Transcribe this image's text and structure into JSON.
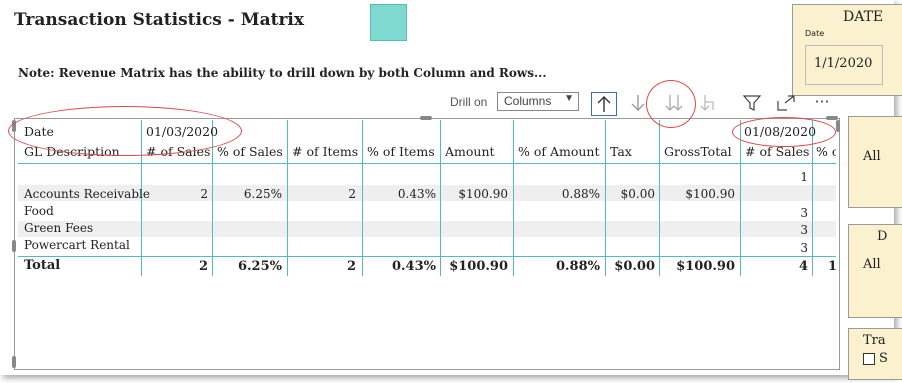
{
  "page": {
    "title": "Transaction Statistics - Matrix",
    "note": "Note: Revenue Matrix has the ability to drill down by both Column and Rows..."
  },
  "slicers": {
    "date_header": "DATE",
    "date_label": "Date",
    "date_value": "1/1/2020",
    "slicer2_value": "All",
    "slicer3_header": "D",
    "slicer3_value": "All",
    "slicer4_header": "Tra",
    "slicer4_option": "S"
  },
  "toolbar": {
    "drill_label": "Drill on",
    "drill_value": "Columns",
    "more_label": "···"
  },
  "matrix": {
    "date_row_label": "Date",
    "date1": "01/03/2020",
    "date2": "01/08/2020",
    "row_header": "GL Description",
    "col_headers": [
      "# of Sales",
      "% of Sales",
      "# of Items",
      "% of Items",
      "Amount",
      "% of Amount",
      "Tax",
      "GrossTotal",
      "# of Sales",
      "% c"
    ],
    "top_row_value": "1",
    "rows": [
      {
        "label": "Accounts Receivable",
        "sales": "2",
        "pct_sales": "6.25%",
        "items": "2",
        "pct_items": "0.43%",
        "amount": "$100.90",
        "pct_amount": "0.88%",
        "tax": "$0.00",
        "gross": "$100.90",
        "sales2": ""
      },
      {
        "label": "Food",
        "sales2": "3"
      },
      {
        "label": "Green Fees",
        "sales2": "3"
      },
      {
        "label": "Powercart Rental",
        "sales2": "3"
      }
    ],
    "total": {
      "label": "Total",
      "sales": "2",
      "pct_sales": "6.25%",
      "items": "2",
      "pct_items": "0.43%",
      "amount": "$100.90",
      "pct_amount": "0.88%",
      "tax": "$0.00",
      "gross": "$100.90",
      "sales2": "4",
      "partial": "1"
    }
  },
  "colors": {
    "accent": "#56b9c0",
    "slicer_bg": "#fbf1cf",
    "annotation": "#d94a4a",
    "swatch": "#7fd9d0"
  }
}
